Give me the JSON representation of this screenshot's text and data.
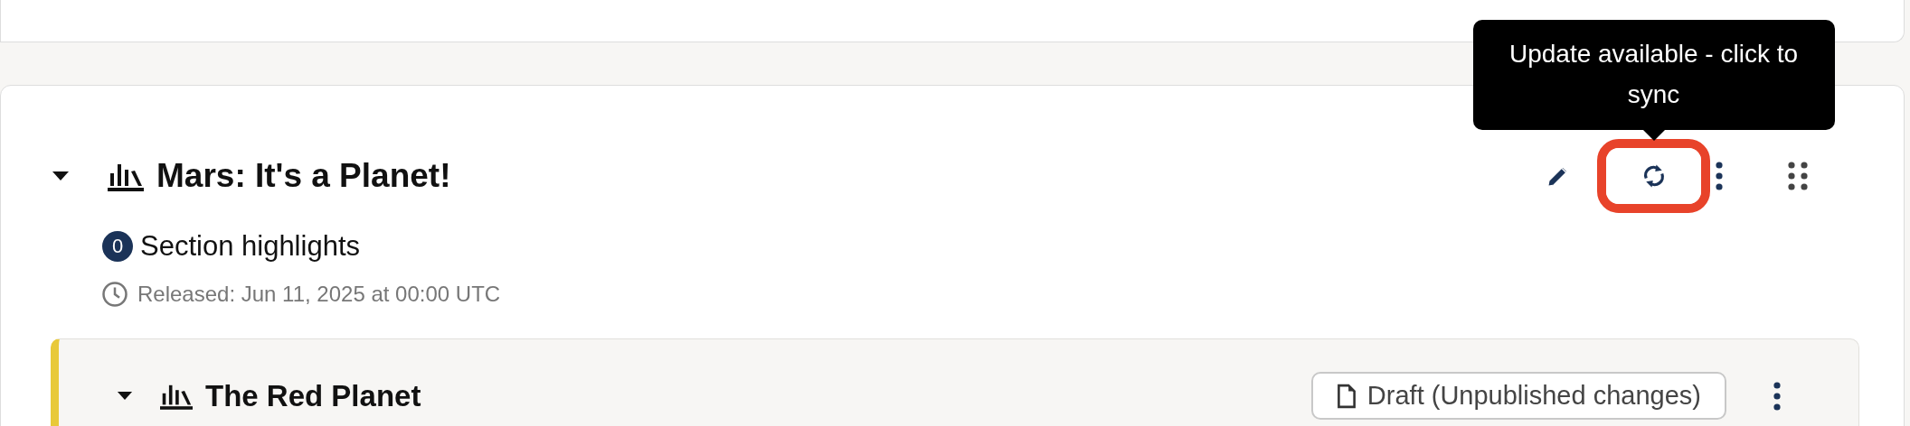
{
  "section": {
    "expanded": true,
    "title": "Mars: It's a Planet!",
    "highlights": {
      "count": "0",
      "label": "Section highlights"
    },
    "release": "Released: Jun 11, 2025 at 00:00 UTC",
    "sync_button": {
      "highlighted": true
    },
    "tooltip": "Update available - click to sync",
    "subsections": [
      {
        "expanded": true,
        "title": "The Red Planet",
        "status": "Draft (Unpublished changes)"
      }
    ]
  }
}
